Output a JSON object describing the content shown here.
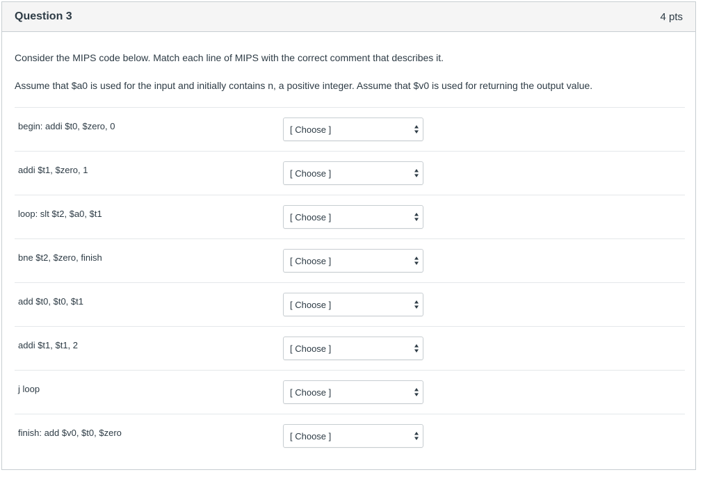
{
  "question": {
    "title": "Question 3",
    "points": "4 pts",
    "text_1": "Consider the MIPS code below.  Match each line of MIPS with the correct comment that describes it.",
    "text_2": "Assume that $a0 is used for the input and initially contains n, a positive integer.  Assume that $v0 is used for returning the output value."
  },
  "rows": [
    {
      "label": "begin: addi $t0, $zero, 0",
      "selected": "[ Choose ]"
    },
    {
      "label": "addi $t1, $zero, 1",
      "selected": "[ Choose ]"
    },
    {
      "label": "loop: slt $t2, $a0, $t1",
      "selected": "[ Choose ]"
    },
    {
      "label": "bne $t2, $zero, finish",
      "selected": "[ Choose ]"
    },
    {
      "label": "add $t0, $t0, $t1",
      "selected": "[ Choose ]"
    },
    {
      "label": "addi $t1, $t1, 2",
      "selected": "[ Choose ]"
    },
    {
      "label": "j loop",
      "selected": "[ Choose ]"
    },
    {
      "label": "finish: add $v0, $t0, $zero",
      "selected": "[ Choose ]"
    }
  ],
  "icons": {
    "select_arrow": "up-down-arrows-icon"
  }
}
